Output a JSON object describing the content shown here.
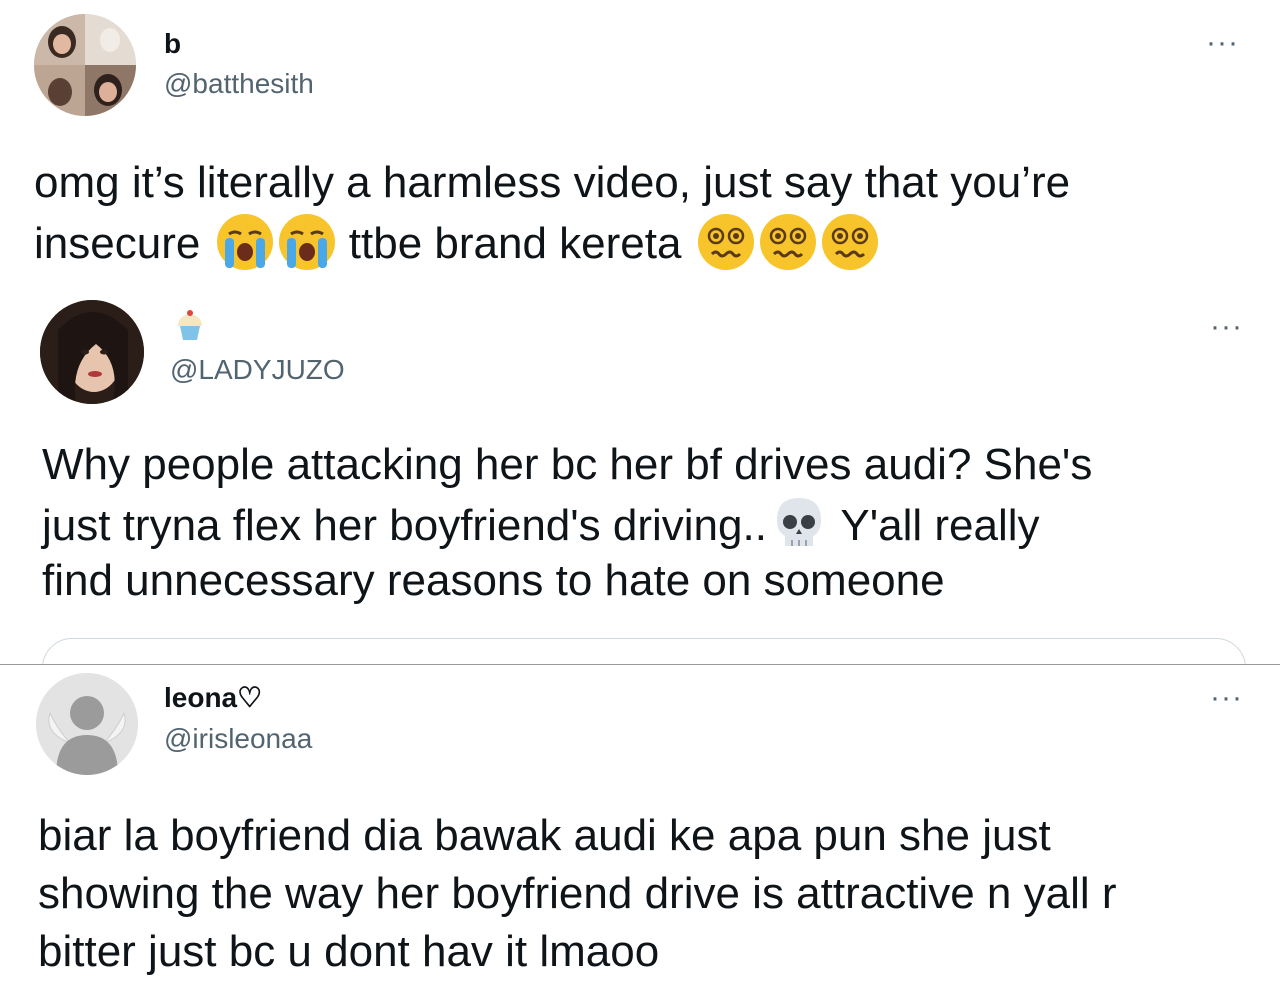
{
  "tweets": [
    {
      "name": "b",
      "handle": "@batthesith",
      "more": "···",
      "line1": "omg it’s literally a harmless video, just say that you’re",
      "line2a": "insecure",
      "line2b": "ttbe brand kereta",
      "emojis": [
        "loudly-crying-face-emoji",
        "loudly-crying-face-emoji",
        "woozy-face-emoji",
        "woozy-face-emoji",
        "woozy-face-emoji"
      ]
    },
    {
      "name_emoji": "cupcake-emoji",
      "handle": "@LADYJUZO",
      "more": "···",
      "line1": "Why people attacking her bc her bf drives audi? She's",
      "line2a": "just tryna flex her boyfriend's driving..",
      "line2b": "Y'all really",
      "line3": "find unnecessary reasons to hate on someone",
      "emojis": [
        "skull-emoji"
      ]
    },
    {
      "name": "leona♡",
      "handle": "@irisleonaa",
      "more": "···",
      "line1": "biar la boyfriend dia bawak audi ke apa pun she just",
      "line2": "showing the way her boyfriend drive is attractive n yall r",
      "line3": "bitter just bc u dont hav it lmaoo"
    }
  ],
  "colors": {
    "text": "#0f1419",
    "muted": "#536471",
    "emoji_yellow": "#f7c52b"
  }
}
